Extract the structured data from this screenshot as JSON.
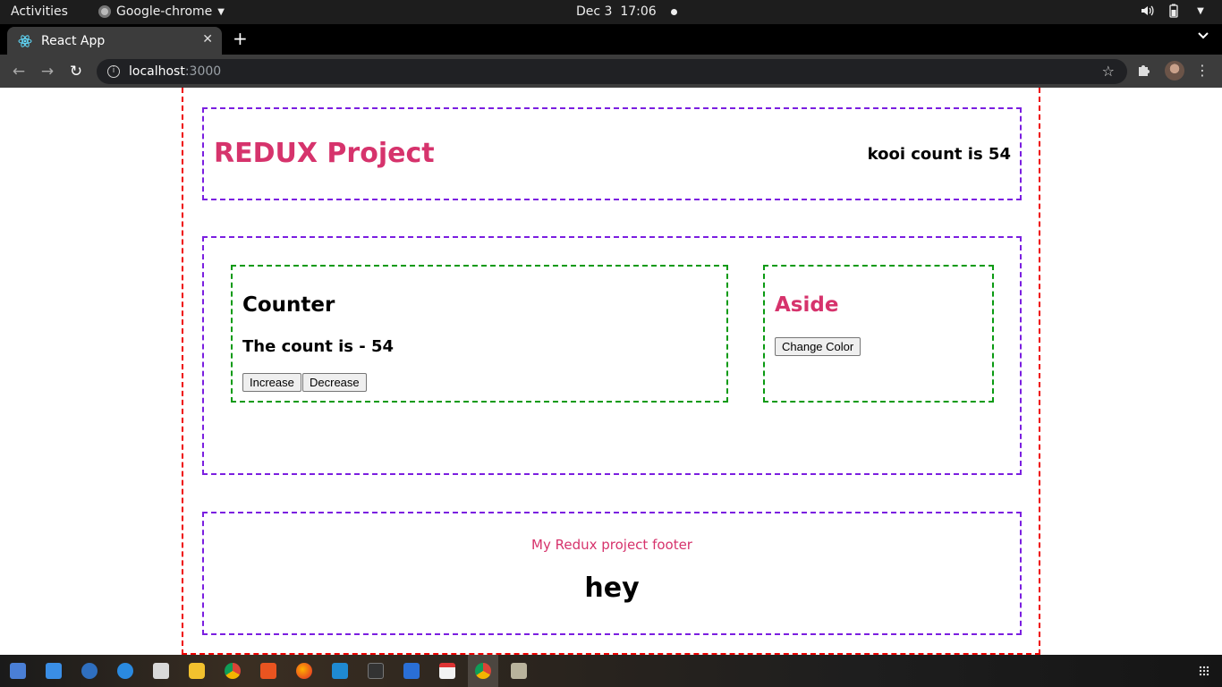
{
  "system_bar": {
    "activities": "Activities",
    "app_name": "Google-chrome",
    "date": "Dec 3",
    "time": "17:06"
  },
  "browser": {
    "tab_title": "React App",
    "url_host": "localhost",
    "url_port": ":3000"
  },
  "page": {
    "header": {
      "title": "REDUX Project",
      "count_text": "kooi count is 54"
    },
    "counter": {
      "heading": "Counter",
      "count_text": "The count is - 54",
      "increase_label": "Increase",
      "decrease_label": "Decrease"
    },
    "aside": {
      "heading": "Aside",
      "change_color_label": "Change Color"
    },
    "footer": {
      "text": "My Redux project footer",
      "hey": "hey"
    },
    "colors": {
      "accent": "#d6336c",
      "app_border": "#e00000",
      "section_border": "#7b1fe0",
      "box_border": "#0a9a12"
    }
  },
  "dock": {
    "icons": [
      "workspace-icon",
      "text-editor-icon",
      "thunderbird-icon",
      "help-icon",
      "files-icon",
      "rhythmbox-icon",
      "chrome-icon",
      "software-icon",
      "firefox-icon",
      "vscode-icon",
      "terminal-icon",
      "notes-icon",
      "calendar-icon",
      "chrome-active-icon",
      "archive-icon"
    ]
  }
}
